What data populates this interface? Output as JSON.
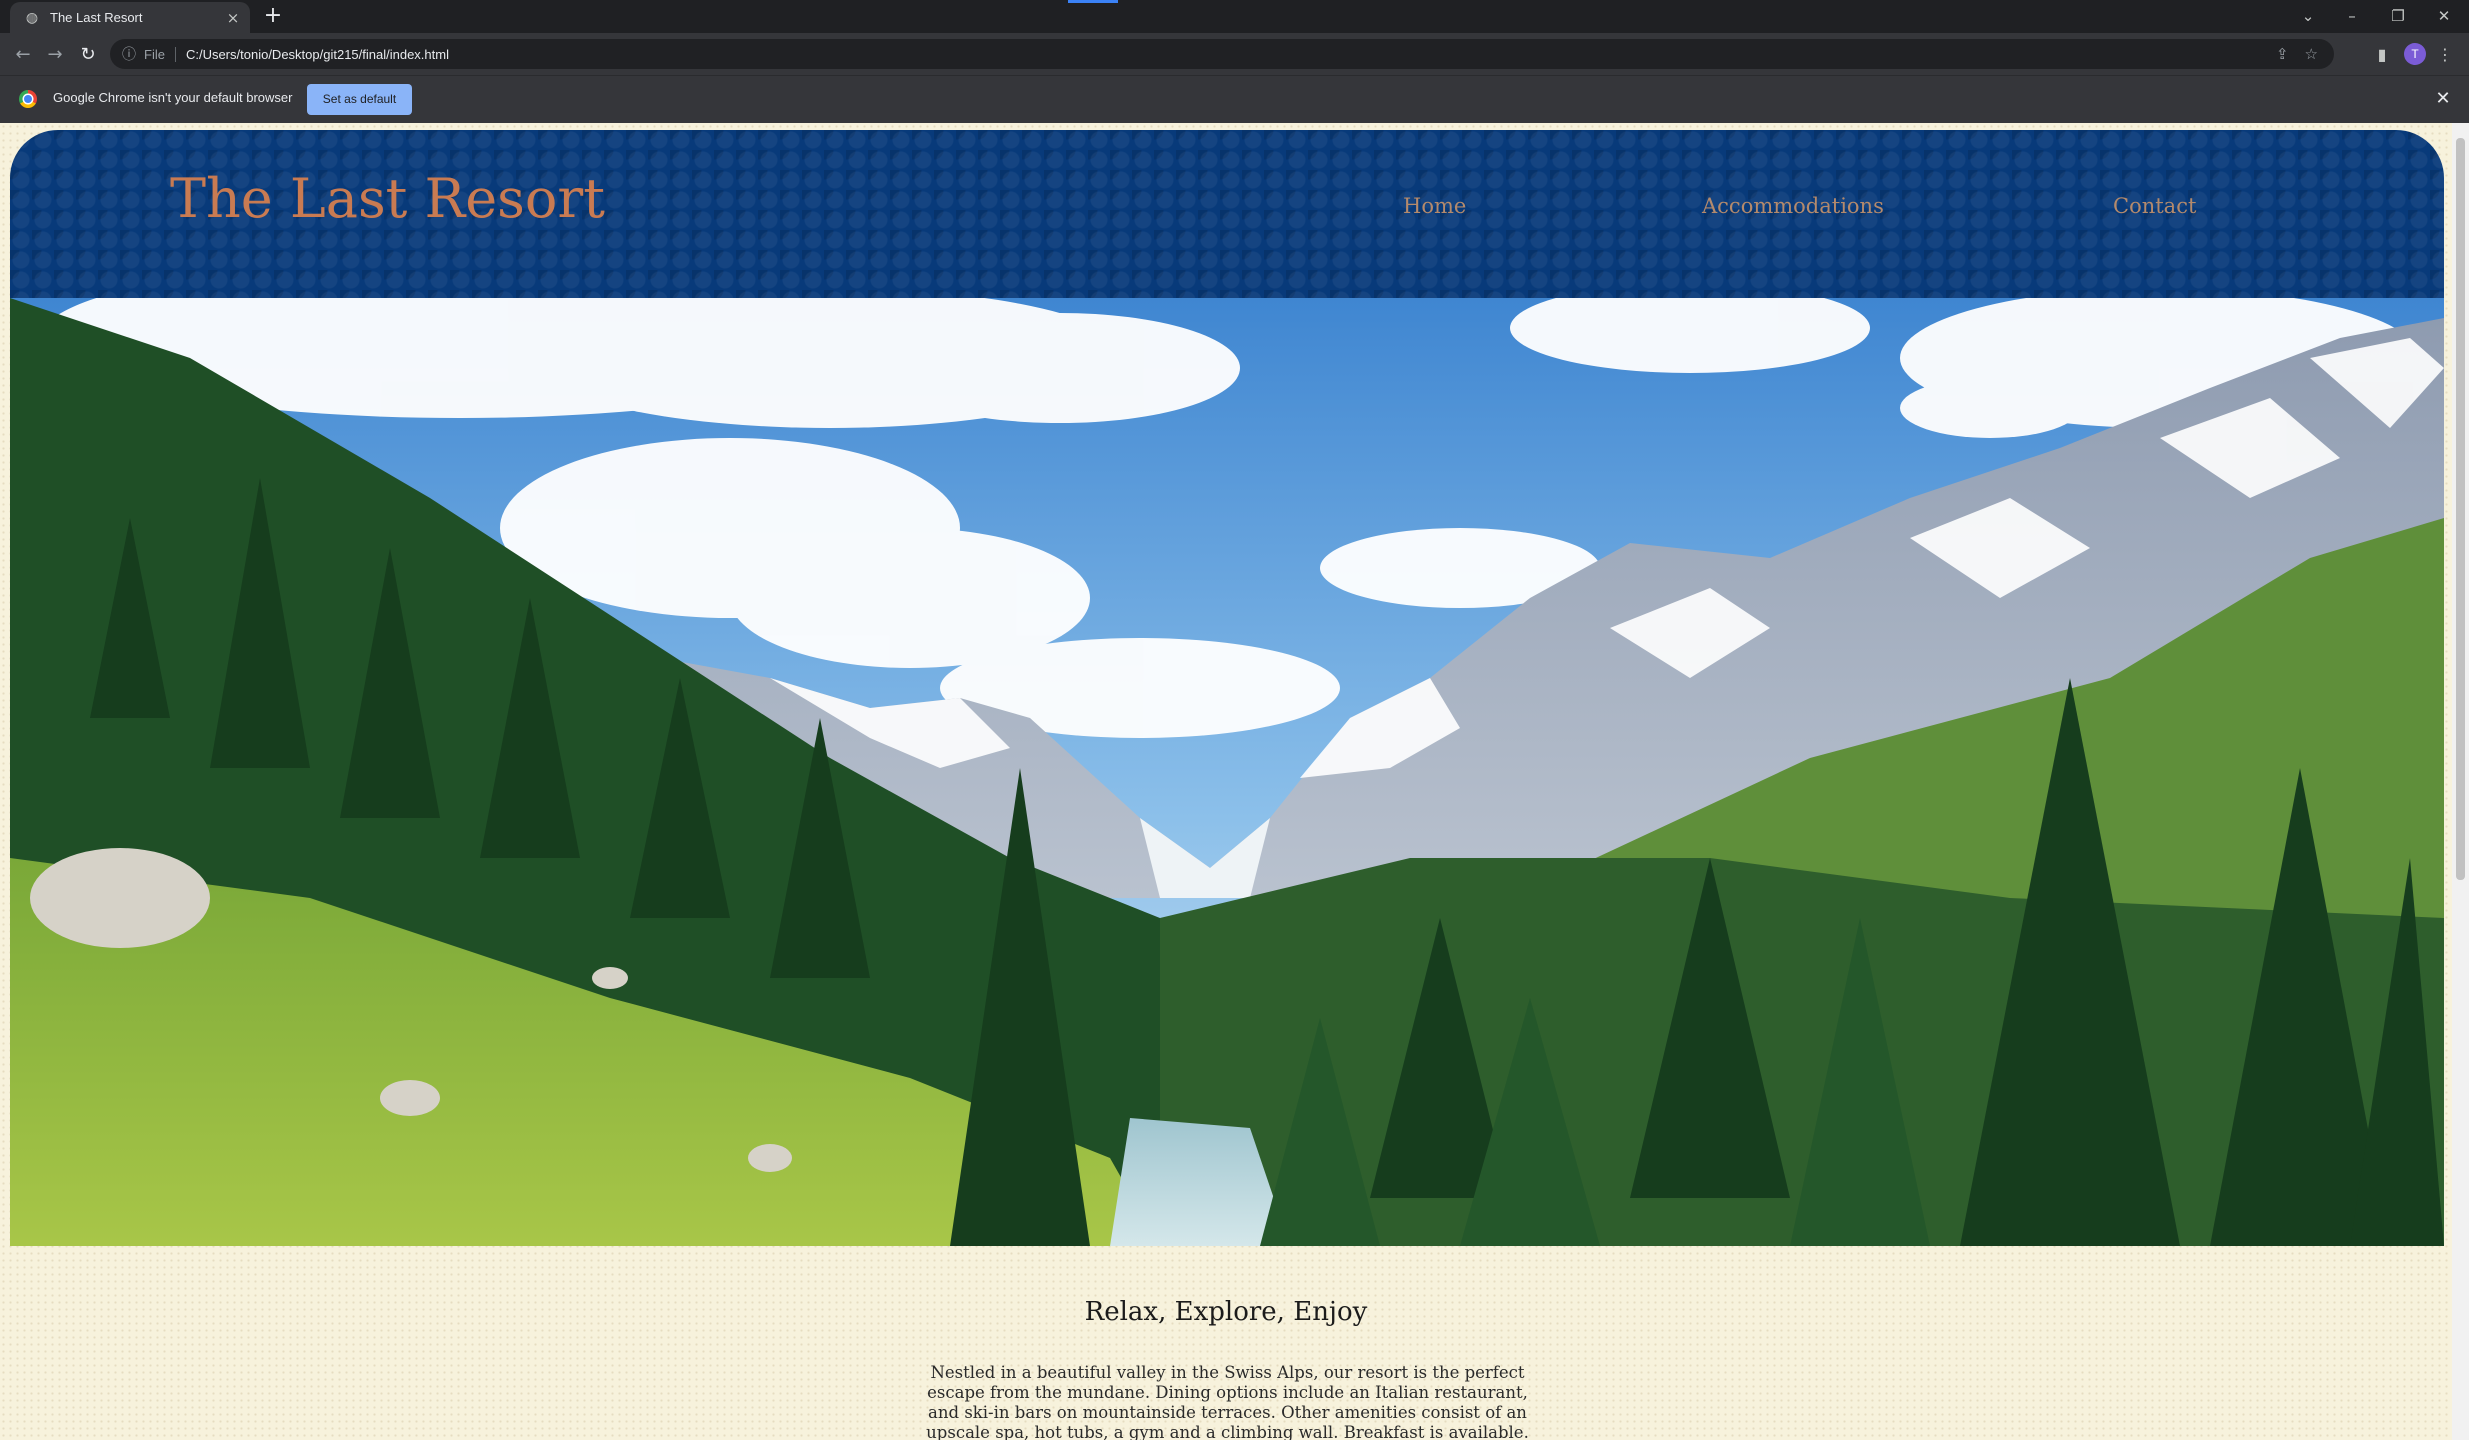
{
  "browser": {
    "tab_title": "The Last Resort",
    "url_scheme": "File",
    "url": "C:/Users/tonio/Desktop/git215/final/index.html",
    "profile_initial": "T",
    "infobar_message": "Google Chrome isn't your default browser",
    "infobar_button": "Set as default"
  },
  "site": {
    "title": "The Last Resort",
    "nav": [
      "Home",
      "Accommodations",
      "Contact"
    ],
    "tagline": "Relax, Explore, Enjoy",
    "intro": "Nestled in a beautiful valley in the Swiss Alps, our resort is the perfect escape from the mundane. Dining options include an Italian restaurant, and ski-in bars on mountainside terraces. Other amenities consist of an upscale spa, hot tubs, a gym and a climbing wall. Breakfast is available."
  },
  "colors": {
    "header_bg": "#083a7a",
    "title": "#c97b52",
    "nav_link": "#b48a6c",
    "page_bg": "#f7f2dc"
  },
  "hero_image": {
    "icon": "mountain-valley-photo"
  }
}
